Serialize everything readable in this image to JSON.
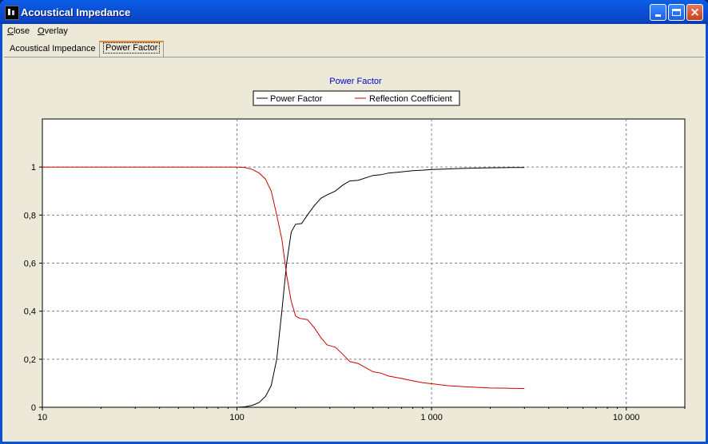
{
  "window": {
    "title": "Acoustical Impedance",
    "icon": "app-icon"
  },
  "menu": {
    "close_rest": "lose",
    "close_accel": "C",
    "overlay_rest": "verlay",
    "overlay_accel": "O"
  },
  "tabs": [
    {
      "label": "Acoustical Impedance",
      "active": false
    },
    {
      "label": "Power Factor",
      "active": true
    }
  ],
  "colors": {
    "power_factor": "#000000",
    "reflection": "#cc0000",
    "title": "#0000cc",
    "grid": "#808080"
  },
  "chart_data": {
    "type": "line",
    "title": "Power Factor",
    "x_scale": "log",
    "xlim": [
      10,
      20000
    ],
    "ylim": [
      0,
      1.2
    ],
    "x_ticks": [
      10,
      100,
      1000,
      10000
    ],
    "x_tick_labels": [
      "10",
      "100",
      "1 000",
      "10 000"
    ],
    "y_ticks": [
      0,
      0.2,
      0.4,
      0.6,
      0.8,
      1
    ],
    "y_tick_labels": [
      "0",
      "0,2",
      "0,4",
      "0,6",
      "0,8",
      "1"
    ],
    "grid": true,
    "legend_position": "top-center",
    "series": [
      {
        "name": "Power Factor",
        "color": "#000000",
        "points": [
          [
            10,
            0
          ],
          [
            100,
            0
          ],
          [
            110,
            0.002
          ],
          [
            120,
            0.008
          ],
          [
            130,
            0.02
          ],
          [
            140,
            0.045
          ],
          [
            150,
            0.09
          ],
          [
            160,
            0.2
          ],
          [
            170,
            0.4
          ],
          [
            180,
            0.6
          ],
          [
            190,
            0.73
          ],
          [
            200,
            0.762
          ],
          [
            215,
            0.765
          ],
          [
            230,
            0.8
          ],
          [
            250,
            0.84
          ],
          [
            270,
            0.87
          ],
          [
            290,
            0.884
          ],
          [
            320,
            0.9
          ],
          [
            350,
            0.925
          ],
          [
            380,
            0.942
          ],
          [
            420,
            0.945
          ],
          [
            470,
            0.958
          ],
          [
            500,
            0.965
          ],
          [
            550,
            0.968
          ],
          [
            600,
            0.975
          ],
          [
            700,
            0.98
          ],
          [
            800,
            0.985
          ],
          [
            900,
            0.987
          ],
          [
            1000,
            0.99
          ],
          [
            1200,
            0.992
          ],
          [
            1500,
            0.995
          ],
          [
            2000,
            0.997
          ],
          [
            2500,
            0.998
          ],
          [
            3000,
            0.998
          ]
        ]
      },
      {
        "name": "Reflection Coefficient",
        "color": "#cc0000",
        "points": [
          [
            10,
            1
          ],
          [
            100,
            1
          ],
          [
            110,
            0.998
          ],
          [
            120,
            0.99
          ],
          [
            130,
            0.975
          ],
          [
            140,
            0.95
          ],
          [
            150,
            0.9
          ],
          [
            160,
            0.8
          ],
          [
            170,
            0.7
          ],
          [
            180,
            0.55
          ],
          [
            190,
            0.44
          ],
          [
            200,
            0.38
          ],
          [
            210,
            0.37
          ],
          [
            230,
            0.365
          ],
          [
            250,
            0.33
          ],
          [
            270,
            0.29
          ],
          [
            290,
            0.26
          ],
          [
            320,
            0.25
          ],
          [
            350,
            0.22
          ],
          [
            380,
            0.19
          ],
          [
            420,
            0.182
          ],
          [
            470,
            0.16
          ],
          [
            500,
            0.148
          ],
          [
            550,
            0.142
          ],
          [
            600,
            0.13
          ],
          [
            700,
            0.12
          ],
          [
            800,
            0.11
          ],
          [
            900,
            0.102
          ],
          [
            1000,
            0.098
          ],
          [
            1200,
            0.09
          ],
          [
            1500,
            0.085
          ],
          [
            2000,
            0.08
          ],
          [
            2500,
            0.079
          ],
          [
            3000,
            0.078
          ]
        ]
      }
    ]
  }
}
